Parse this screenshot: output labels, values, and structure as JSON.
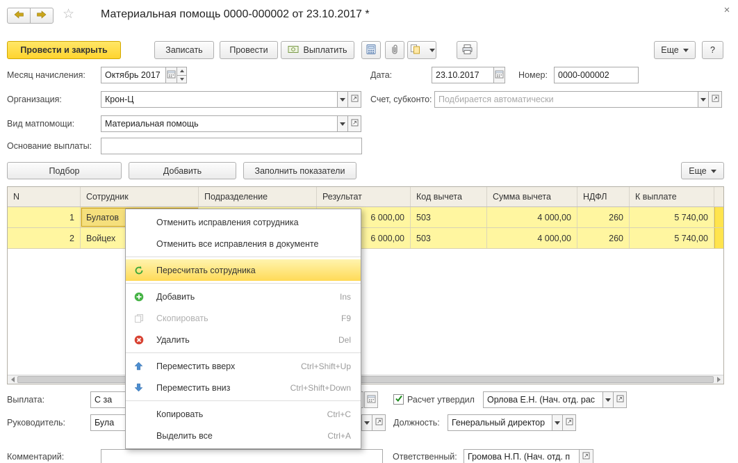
{
  "window": {
    "title": "Материальная помощь 0000-000002 от 23.10.2017 *"
  },
  "icons": {
    "favorite_star": "☆",
    "close": "×",
    "help": "?"
  },
  "command_bar": {
    "post_and_close": "Провести и закрыть",
    "write": "Записать",
    "post": "Провести",
    "pay": "Выплатить",
    "more": "Еще",
    "help": "?"
  },
  "header_fields": {
    "month_label": "Месяц начисления:",
    "month_value": "Октябрь 2017",
    "date_label": "Дата:",
    "date_value": "23.10.2017",
    "number_label": "Номер:",
    "number_value": "0000-000002",
    "organization_label": "Организация:",
    "organization_value": "Крон-Ц",
    "account_label": "Счет, субконто:",
    "account_placeholder": "Подбирается автоматически",
    "aid_type_label": "Вид матпомощи:",
    "aid_type_value": "Материальная помощь",
    "basis_label": "Основание выплаты:",
    "basis_value": ""
  },
  "table_toolbar": {
    "pick": "Подбор",
    "add": "Добавить",
    "fill_indicators": "Заполнить показатели",
    "more": "Еще"
  },
  "table": {
    "columns": [
      "N",
      "Сотрудник",
      "Подразделение",
      "Результат",
      "Код вычета",
      "Сумма вычета",
      "НДФЛ",
      "К выплате"
    ],
    "rows": [
      {
        "n": "1",
        "employee": "Булатов",
        "department": "",
        "result": "6 000,00",
        "deduction_code": "503",
        "deduction_sum": "4 000,00",
        "ndfl": "260",
        "payout": "5 740,00"
      },
      {
        "n": "2",
        "employee": "Войцех",
        "department": "",
        "result": "6 000,00",
        "deduction_code": "503",
        "deduction_sum": "4 000,00",
        "ndfl": "260",
        "payout": "5 740,00"
      }
    ]
  },
  "context_menu": {
    "items": [
      {
        "label": "Отменить исправления сотрудника",
        "shortcut": ""
      },
      {
        "label": "Отменить все исправления в документе",
        "shortcut": ""
      },
      {
        "label": "Пересчитать сотрудника",
        "shortcut": ""
      },
      {
        "label": "Добавить",
        "shortcut": "Ins"
      },
      {
        "label": "Скопировать",
        "shortcut": "F9"
      },
      {
        "label": "Удалить",
        "shortcut": "Del"
      },
      {
        "label": "Переместить вверх",
        "shortcut": "Ctrl+Shift+Up"
      },
      {
        "label": "Переместить вниз",
        "shortcut": "Ctrl+Shift+Down"
      },
      {
        "label": "Копировать",
        "shortcut": "Ctrl+C"
      },
      {
        "label": "Выделить все",
        "shortcut": "Ctrl+A"
      }
    ]
  },
  "footer": {
    "payment_label": "Выплата:",
    "payment_value": "С за",
    "approved_label": "Расчет утвердил",
    "approved_checked": true,
    "approved_value": "Орлова Е.Н. (Нач. отд. рас",
    "manager_label": "Руководитель:",
    "manager_value": "Була",
    "position_label": "Должность:",
    "position_value": "Генеральный директор",
    "comment_label": "Комментарий:",
    "comment_value": "",
    "responsible_label": "Ответственный:",
    "responsible_value": "Громова Н.П. (Нач. отд. п"
  },
  "colors": {
    "accent_yellow": "#ffd42e",
    "row_highlight": "#fff6a0",
    "menu_highlight": "#ffda57"
  }
}
